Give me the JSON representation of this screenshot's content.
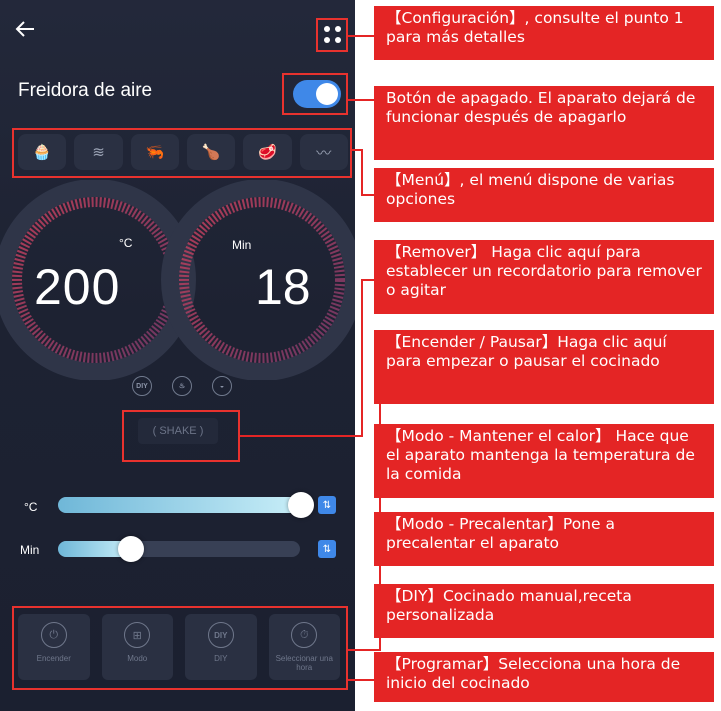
{
  "app": {
    "title": "Freidora de aire",
    "power_on": true
  },
  "menu_items": [
    {
      "icon": "cupcake-icon",
      "glyph": "🧁"
    },
    {
      "icon": "fries-icon",
      "glyph": "≋"
    },
    {
      "icon": "shrimp-icon",
      "glyph": "🦐"
    },
    {
      "icon": "drumstick-icon",
      "glyph": "🍗"
    },
    {
      "icon": "steak-icon",
      "glyph": "🥩"
    },
    {
      "icon": "bacon-icon",
      "glyph": "〰"
    }
  ],
  "dials": {
    "temperature": {
      "unit": "°C",
      "value": "200"
    },
    "time": {
      "unit": "Min",
      "value": "18"
    }
  },
  "mode_icons": [
    {
      "icon": "diy-icon",
      "label": "DIY"
    },
    {
      "icon": "flame-icon",
      "label": "♨"
    },
    {
      "icon": "keep-warm-icon",
      "label": "◒"
    }
  ],
  "shake": {
    "label": "( SHAKE )"
  },
  "sliders": {
    "temperature": {
      "label": "°C",
      "level": 0.97
    },
    "time": {
      "label": "Min",
      "level": 0.3
    }
  },
  "bottom_buttons": [
    {
      "label": "Encender",
      "glyph": "⏻"
    },
    {
      "label": "Modo",
      "glyph": "⊞"
    },
    {
      "label": "DIY",
      "glyph": "DIY"
    },
    {
      "label": "Seleccionar una hora",
      "glyph": "⏱"
    }
  ],
  "annotations": [
    "【Configuración】, consulte el punto 1 para más detalles",
    "Botón de apagado. El aparato dejará de funcionar después de apagarlo",
    "【Menú】, el menú dispone de varias opciones",
    "【Remover】 Haga clic aquí para establecer un recordatorio para remover o agitar",
    "【Encender / Pausar】Haga clic aquí para empezar o pausar el cocinado",
    "【Modo - Mantener el calor】 Hace que el aparato mantenga la temperatura de la comida",
    "【Modo - Precalentar】Pone a precalentar el aparato",
    "【DIY】Cocinado manual,receta personalizada",
    "【Programar】Selecciona una hora de inicio del cocinado"
  ],
  "colors": {
    "accent": "#3f88e8",
    "annotation": "#e42525",
    "background": "#1d2232"
  }
}
